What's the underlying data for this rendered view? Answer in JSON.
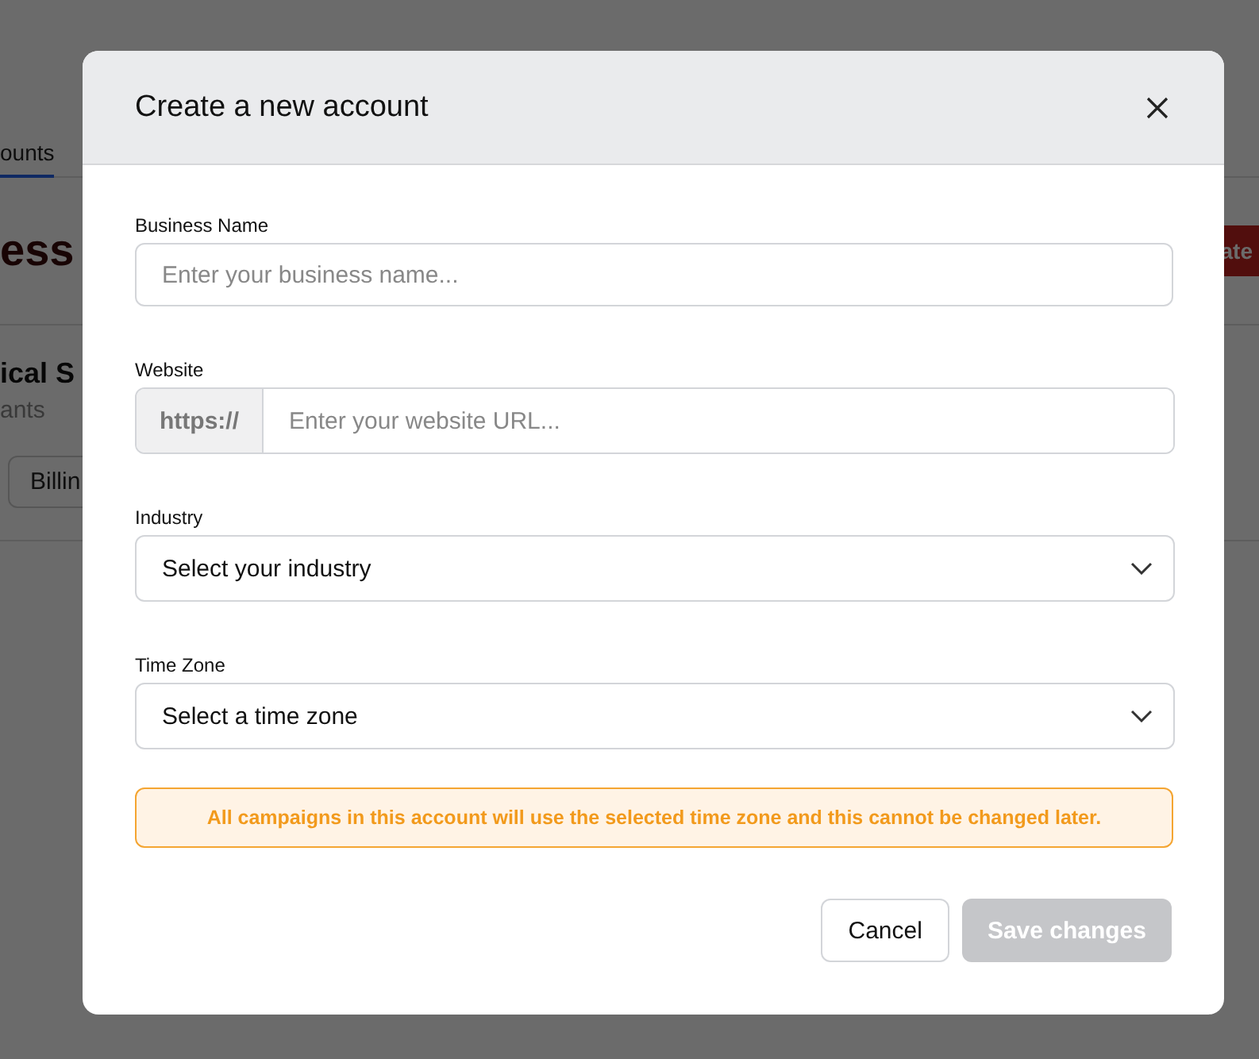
{
  "background": {
    "tab": {
      "label": "ounts",
      "selected": true
    },
    "heading": "ess",
    "create_button": "ate",
    "account_name": "ical S",
    "account_subtitle": "ants",
    "billing_button": "Billin"
  },
  "dialog": {
    "title": "Create a new account",
    "fields": [
      {
        "kind": "text",
        "label": "Business Name",
        "placeholder": "Enter your business name..."
      },
      {
        "kind": "url",
        "label": "Website",
        "prefix": "https://",
        "placeholder": "Enter your website URL..."
      },
      {
        "kind": "select",
        "label": "Industry",
        "value": "Select your industry"
      },
      {
        "kind": "select",
        "label": "Time Zone",
        "value": "Select a time zone"
      }
    ],
    "alert": "All campaigns in this account will use the selected time zone and this cannot be changed later.",
    "buttons": [
      {
        "kind": "secondary",
        "label": "Cancel",
        "disabled": false
      },
      {
        "kind": "primary",
        "label": "Save changes",
        "disabled": true
      }
    ]
  }
}
